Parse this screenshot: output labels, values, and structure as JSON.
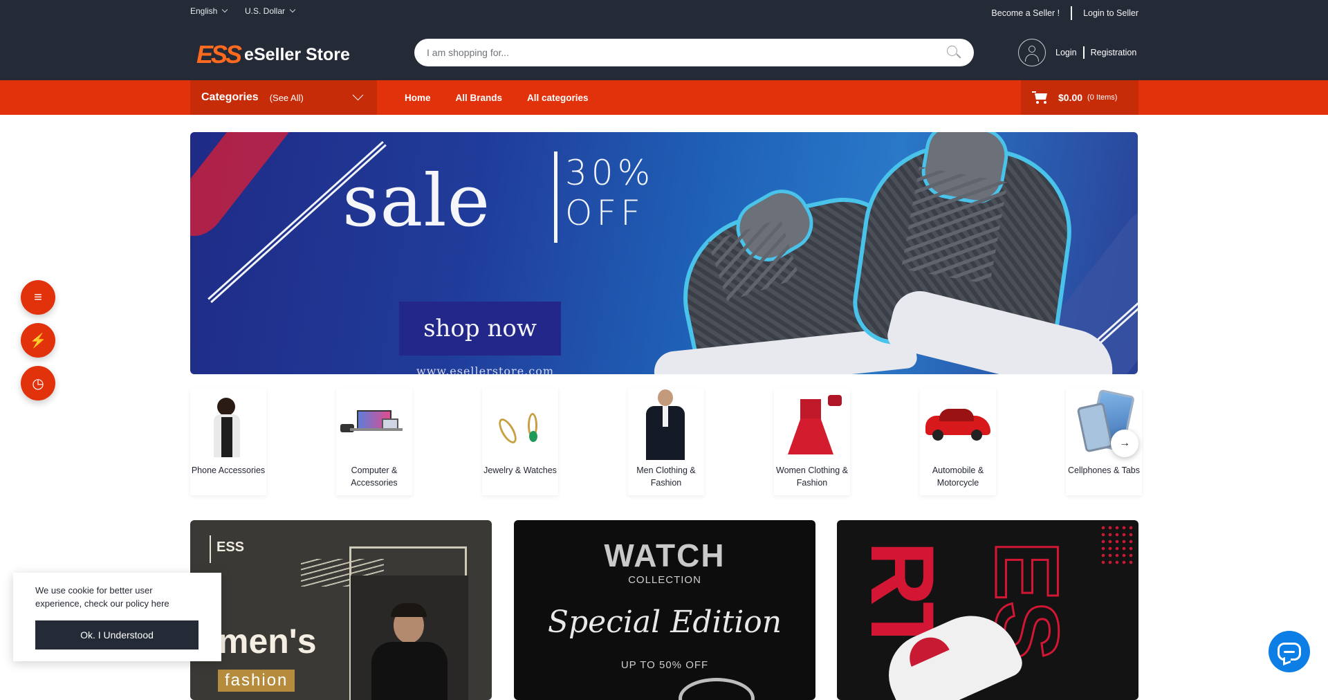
{
  "topbar": {
    "language": "English",
    "currency": "U.S. Dollar",
    "become_seller": "Become a Seller !",
    "login_seller": "Login to Seller"
  },
  "header": {
    "logo_mark": "ESS",
    "logo_text": "eSeller Store",
    "search_placeholder": "I am shopping for...",
    "login": "Login",
    "registration": "Registration"
  },
  "nav": {
    "categories_title": "Categories",
    "categories_see_all": "(See All)",
    "links": [
      "Home",
      "All Brands",
      "All categories"
    ],
    "cart_total": "$0.00",
    "cart_items": "(0 Items)"
  },
  "banner": {
    "sale": "sale",
    "discount_line1": "30%",
    "discount_line2": "OFF",
    "cta": "shop now",
    "url": "www.esellerstore.com"
  },
  "categories": [
    {
      "label": "Phone Accessories"
    },
    {
      "label": "Computer & Accessories"
    },
    {
      "label": "Jewelry & Watches"
    },
    {
      "label": "Men Clothing & Fashion"
    },
    {
      "label": "Women Clothing & Fashion"
    },
    {
      "label": "Automobile & Motorcycle"
    },
    {
      "label": "Cellphones & Tabs"
    }
  ],
  "promos": {
    "p1_brand": "ESS",
    "p1_title": "men's",
    "p1_sub": "fashion",
    "p2_title": "WATCH",
    "p2_collection": "COLLECTION",
    "p2_script": "Special Edition",
    "p2_offer": "UP TO 50% OFF",
    "p3_word1": "RT",
    "p3_word2": "ES"
  },
  "cookie": {
    "text": "We use cookie for better user experience, check our policy here",
    "button": "Ok. I Understood"
  },
  "colors": {
    "topbar": "#242a36",
    "accent": "#e1320c",
    "accent_dark": "#c72c09",
    "logo_orange": "#ff6a1f",
    "chat": "#0c7ee6"
  },
  "icons": {
    "side": [
      "menu-icon",
      "flash-icon",
      "clock-icon"
    ],
    "chat": "chat-bubble-icon",
    "next": "arrow-right-icon"
  }
}
